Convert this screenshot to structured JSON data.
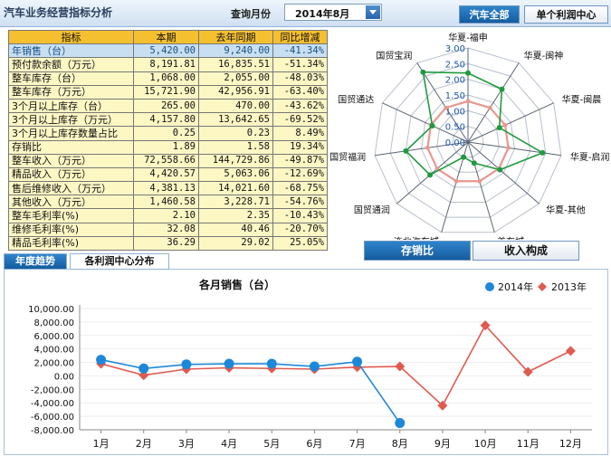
{
  "header": {
    "app_title": "汽车业务经营指标分析",
    "month_label": "查询月份",
    "month_value": "2014年8月",
    "tabs": [
      "汽车全部",
      "单个利润中心"
    ]
  },
  "table": {
    "headers": [
      "指标",
      "本期",
      "去年同期",
      "同比增减"
    ],
    "rows": [
      [
        "年销售（台）",
        "5,420.00",
        "9,240.00",
        "-41.34%"
      ],
      [
        "预付款余额（万元）",
        "8,191.81",
        "16,835.51",
        "-51.34%"
      ],
      [
        "整车库存（台）",
        "1,068.00",
        "2,055.00",
        "-48.03%"
      ],
      [
        "整车库存（万元）",
        "15,721.90",
        "42,956.91",
        "-63.40%"
      ],
      [
        "3个月以上库存（台）",
        "265.00",
        "470.00",
        "-43.62%"
      ],
      [
        "3个月以上库存（万元）",
        "4,157.80",
        "13,642.65",
        "-69.52%"
      ],
      [
        "3个月以上库存数量占比",
        "0.25",
        "0.23",
        "8.49%"
      ],
      [
        "存销比",
        "1.89",
        "1.58",
        "19.34%"
      ],
      [
        "整车收入（万元）",
        "72,558.66",
        "144,729.86",
        "-49.87%"
      ],
      [
        "精品收入（万元）",
        "4,420.57",
        "5,063.06",
        "-12.69%"
      ],
      [
        "售后维修收入（万元）",
        "4,381.13",
        "14,021.60",
        "-68.75%"
      ],
      [
        "其他收入（万元）",
        "1,460.58",
        "3,228.71",
        "-54.76%"
      ],
      [
        "整车毛利率(%)",
        "2.10",
        "2.35",
        "-10.43%"
      ],
      [
        "维修毛利率(%)",
        "32.08",
        "40.46",
        "-20.70%"
      ],
      [
        "精品毛利率(%)",
        "36.29",
        "29.02",
        "25.05%"
      ]
    ]
  },
  "radar_buttons": [
    "存销比",
    "收入构成"
  ],
  "bottom_tabs": [
    "年度趋势",
    "各利润中心分布"
  ],
  "colors": {
    "series_2014": "#1e88d8",
    "series_2013": "#e05a50",
    "radar_current": "#1f9a3e",
    "radar_prior": "#e8978f"
  },
  "chart_data": [
    {
      "type": "radar",
      "axes": [
        "华夏-福申",
        "华夏-闽神",
        "华夏-闽晨",
        "华夏-启润",
        "华夏-其他",
        "美车城",
        "连北汽车城",
        "国贸通润",
        "国贸福润",
        "国贸通达",
        "国贸宝润"
      ],
      "range": [
        0,
        3.0
      ],
      "tick_values": [
        0.0,
        0.5,
        1.0,
        1.5,
        2.0,
        2.5,
        3.0
      ],
      "tick_labels": [
        "0.00",
        "0.50",
        "1.00",
        "1.50",
        "2.00",
        "2.50",
        "3.00"
      ],
      "series": [
        {
          "values": [
            2.2,
            2.0,
            1.1,
            2.4,
            1.35,
            0.7,
            0.5,
            1.6,
            2.0,
            1.25,
            2.65
          ]
        },
        {
          "values": [
            1.3,
            1.3,
            1.3,
            1.3,
            1.3,
            1.3,
            1.3,
            1.3,
            1.3,
            1.3,
            1.3
          ]
        }
      ]
    },
    {
      "type": "line",
      "title": "各月销售（台）",
      "categories": [
        "1月",
        "2月",
        "3月",
        "4月",
        "5月",
        "6月",
        "7月",
        "8月",
        "9月",
        "10月",
        "11月",
        "12月"
      ],
      "y_ticks": [
        "10,000.00",
        "8,000.00",
        "6,000.00",
        "4,000.00",
        "2,000.00",
        "0.00",
        "-2,000.00",
        "-4,000.00",
        "-6,000.00",
        "-8,000.00"
      ],
      "ylim": [
        -8000,
        10000
      ],
      "legend_position": "top-right",
      "series": [
        {
          "name": "2014年",
          "values": [
            2400,
            1100,
            1700,
            1800,
            1800,
            1400,
            2100,
            -7000,
            null,
            null,
            null,
            null
          ]
        },
        {
          "name": "2013年",
          "values": [
            1800,
            100,
            1000,
            1200,
            1100,
            1000,
            1300,
            1400,
            -4400,
            7500,
            600,
            3700
          ]
        }
      ]
    }
  ]
}
